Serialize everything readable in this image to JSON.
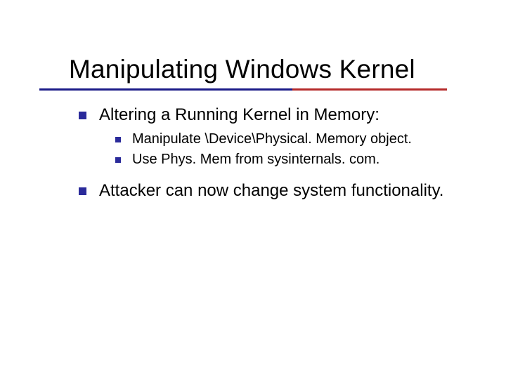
{
  "title": "Manipulating Windows Kernel",
  "bullets": {
    "b0": "Altering a Running Kernel in Memory:",
    "b0a": "Manipulate \\Device\\Physical. Memory object.",
    "b0b": "Use Phys. Mem from sysinternals. com.",
    "b1": "Attacker can now change system functionality."
  }
}
